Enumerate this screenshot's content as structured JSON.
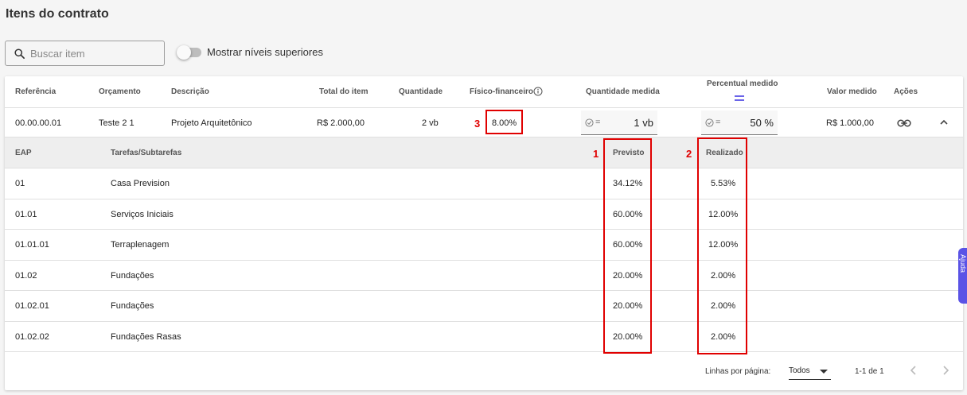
{
  "page": {
    "title": "Itens do contrato"
  },
  "search": {
    "placeholder": "Buscar item"
  },
  "toggle": {
    "label": "Mostrar níveis superiores",
    "on": false
  },
  "columns": {
    "referencia": "Referência",
    "orcamento": "Orçamento",
    "descricao": "Descrição",
    "total": "Total do item",
    "quantidade": "Quantidade",
    "fisico": "Físico-financeiro",
    "qtd_medida": "Quantidade medida",
    "perc_medido": "Percentual medido",
    "valor_medido": "Valor medido",
    "acoes": "Ações"
  },
  "item": {
    "referencia": "00.00.00.01",
    "orcamento": "Teste 2 1",
    "descricao": "Projeto Arquitetônico",
    "total": "R$ 2.000,00",
    "quantidade": "2 vb",
    "fisico": "8.00%",
    "qtd_medida_prefix": "=",
    "qtd_medida_value": "1 vb",
    "perc_medido_prefix": "=",
    "perc_medido_value": "50 %",
    "valor_medido": "R$ 1.000,00"
  },
  "sub_columns": {
    "eap": "EAP",
    "tarefas": "Tarefas/Subtarefas",
    "previsto": "Previsto",
    "realizado": "Realizado"
  },
  "sub_rows": [
    {
      "eap": "01",
      "tarefa": "Casa Prevision",
      "previsto": "34.12%",
      "realizado": "5.53%"
    },
    {
      "eap": "01.01",
      "tarefa": "Serviços Iniciais",
      "previsto": "60.00%",
      "realizado": "12.00%"
    },
    {
      "eap": "01.01.01",
      "tarefa": "Terraplenagem",
      "previsto": "60.00%",
      "realizado": "12.00%"
    },
    {
      "eap": "01.02",
      "tarefa": "Fundações",
      "previsto": "20.00%",
      "realizado": "2.00%"
    },
    {
      "eap": "01.02.01",
      "tarefa": "Fundações",
      "previsto": "20.00%",
      "realizado": "2.00%"
    },
    {
      "eap": "01.02.02",
      "tarefa": "Fundações Rasas",
      "previsto": "20.00%",
      "realizado": "2.00%"
    }
  ],
  "footer": {
    "rows_label": "Linhas por página:",
    "rows_value": "Todos",
    "range": "1-1 de 1"
  },
  "annotations": {
    "one": "1",
    "two": "2",
    "three": "3"
  },
  "help_tab": "Ajuda",
  "colors": {
    "annotation": "#e00000",
    "accent": "#5a53e6"
  },
  "icons": [
    "search-icon",
    "info-icon",
    "check-circle-icon",
    "link-icon",
    "chevron-up-icon",
    "chevron-left-icon",
    "chevron-right-icon",
    "caret-down-icon",
    "equals-icon"
  ]
}
